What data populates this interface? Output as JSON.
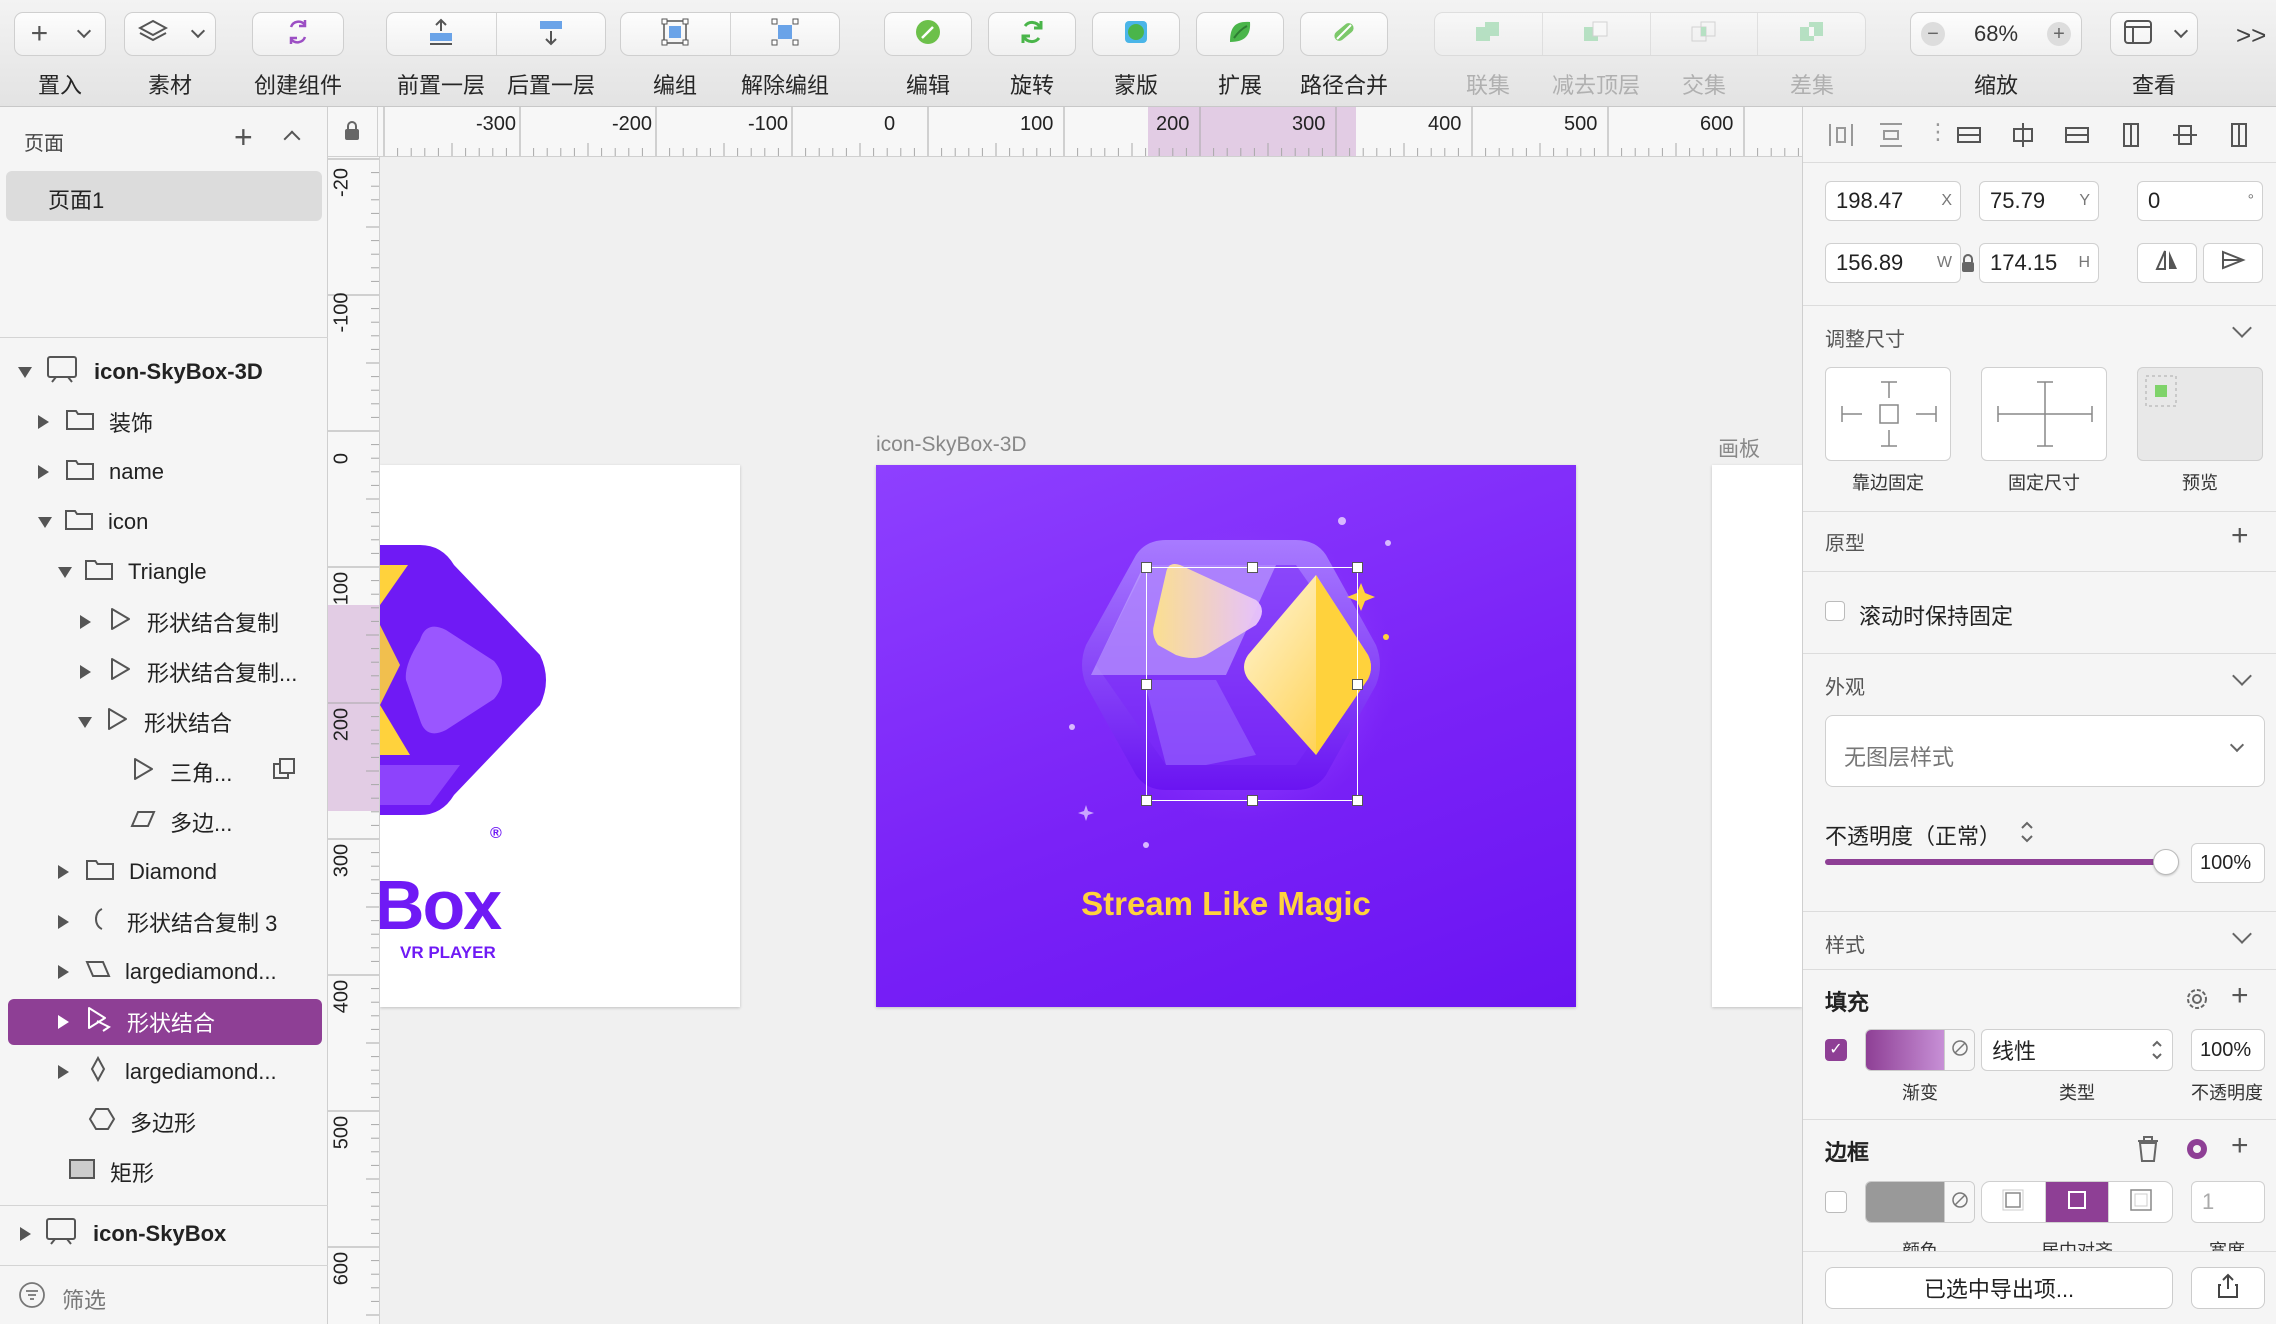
{
  "toolbar": {
    "insert": "置入",
    "assets": "素材",
    "create_symbol": "创建组件",
    "forward": "前置一层",
    "backward": "后置一层",
    "group": "编组",
    "ungroup": "解除编组",
    "edit": "编辑",
    "rotate": "旋转",
    "mask": "蒙版",
    "scale": "扩展",
    "flatten": "路径合并",
    "union": "联集",
    "subtract": "减去顶层",
    "intersect": "交集",
    "difference": "差集",
    "zoom_value": "68%",
    "zoom_label": "缩放",
    "view_label": "查看",
    "more": ">>"
  },
  "left_panel": {
    "pages_title": "页面",
    "page_1": "页面1",
    "filter": "筛选",
    "layers": [
      {
        "label": "icon-SkyBox-3D"
      },
      {
        "label": "装饰"
      },
      {
        "label": "name"
      },
      {
        "label": "icon"
      },
      {
        "label": "Triangle"
      },
      {
        "label": "形状结合复制"
      },
      {
        "label": "形状结合复制..."
      },
      {
        "label": "形状结合"
      },
      {
        "label": "三角..."
      },
      {
        "label": "多边..."
      },
      {
        "label": "Diamond"
      },
      {
        "label": "形状结合复制 3"
      },
      {
        "label": "largediamond..."
      },
      {
        "label": "形状结合"
      },
      {
        "label": "largediamond..."
      },
      {
        "label": "多边形"
      },
      {
        "label": "矩形"
      },
      {
        "label": "icon-SkyBox"
      }
    ]
  },
  "rulers": {
    "top": [
      "-300",
      "-200",
      "-100",
      "0",
      "100",
      "200",
      "300",
      "400",
      "500",
      "600"
    ],
    "left": [
      "-20",
      "-100",
      "0",
      "100",
      "200",
      "300",
      "400",
      "500",
      "600"
    ]
  },
  "canvas": {
    "artboard_main_title": "icon-SkyBox-3D",
    "artboard_right_title": "画板",
    "tagline": "Stream Like Magic",
    "left_brand": "Box",
    "left_sub": "VR PLAYER",
    "registered": "®"
  },
  "inspector": {
    "x": "198.47",
    "x_suffix": "X",
    "y": "75.79",
    "y_suffix": "Y",
    "rotation": "0",
    "rotation_suffix": "°",
    "w": "156.89",
    "w_suffix": "W",
    "h": "174.15",
    "h_suffix": "H",
    "resize_title": "调整尺寸",
    "pin_edge": "靠边固定",
    "fix_size": "固定尺寸",
    "preview": "预览",
    "prototype_title": "原型",
    "fix_on_scroll": "滚动时保持固定",
    "appearance_title": "外观",
    "layer_style": "无图层样式",
    "opacity_label": "不透明度（正常）",
    "opacity_value": "100%",
    "opacity_fraction": 1.0,
    "style_title": "样式",
    "fill_title": "填充",
    "fill_type": "线性",
    "fill_opacity": "100%",
    "fill_kind_label": "渐变",
    "fill_type_label": "类型",
    "fill_opacity_label": "不透明度",
    "border_title": "边框",
    "border_width": "1",
    "border_color_label": "颜色",
    "border_pos_label": "居中对齐",
    "border_width_label": "宽度",
    "export_btn": "已选中导出项..."
  },
  "colors": {
    "accent": "#8e3f95",
    "artboard_top": "#8a3cff",
    "artboard_bottom": "#6a14f2",
    "tagline": "#ffd23c",
    "brand_purple": "#6f1af5"
  }
}
